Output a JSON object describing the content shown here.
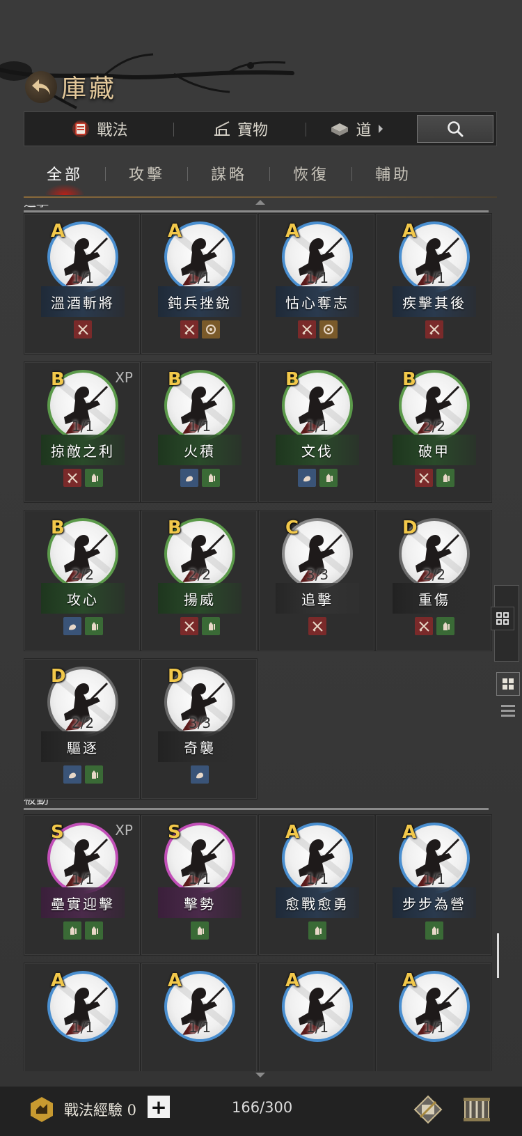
{
  "header": {
    "title": "庫藏"
  },
  "top_tabs": [
    {
      "label": "戰法",
      "icon": "war-tactic-icon"
    },
    {
      "label": "寶物",
      "icon": "treasure-icon"
    },
    {
      "label": "道",
      "icon": "item-icon"
    }
  ],
  "sub_tabs": [
    "全部",
    "攻擊",
    "謀略",
    "恢復",
    "輔助"
  ],
  "colors": {
    "accent": "#e3c89a",
    "S": "#c24fb8",
    "A": "#4a8fd0",
    "B": "#5b9a4a",
    "C": "#8a8a8a",
    "D": "#6a6a6a"
  },
  "sections": [
    {
      "label": "追擊",
      "tactics": [
        {
          "grade": "A",
          "count": "1/1",
          "name": "溫酒斬將",
          "xp": "",
          "tags": [
            "red"
          ]
        },
        {
          "grade": "A",
          "count": "1/1",
          "name": "鈍兵挫銳",
          "xp": "",
          "tags": [
            "red",
            "brown"
          ]
        },
        {
          "grade": "A",
          "count": "1/1",
          "name": "怙心奪志",
          "xp": "",
          "tags": [
            "red",
            "brown"
          ]
        },
        {
          "grade": "A",
          "count": "1/1",
          "name": "疾擊其後",
          "xp": "",
          "tags": [
            "red"
          ]
        },
        {
          "grade": "B",
          "count": "1/1",
          "name": "掠敵之利",
          "xp": "XP",
          "tags": [
            "red",
            "green"
          ]
        },
        {
          "grade": "B",
          "count": "1/1",
          "name": "火積",
          "xp": "",
          "tags": [
            "blue",
            "green"
          ]
        },
        {
          "grade": "B",
          "count": "1/1",
          "name": "文伐",
          "xp": "",
          "tags": [
            "blue",
            "green"
          ]
        },
        {
          "grade": "B",
          "count": "2/2",
          "name": "破甲",
          "xp": "",
          "tags": [
            "red",
            "green"
          ]
        },
        {
          "grade": "B",
          "count": "2/2",
          "name": "攻心",
          "xp": "",
          "tags": [
            "blue",
            "green"
          ]
        },
        {
          "grade": "B",
          "count": "2/2",
          "name": "揚威",
          "xp": "",
          "tags": [
            "red",
            "green"
          ]
        },
        {
          "grade": "C",
          "count": "3/3",
          "name": "追擊",
          "xp": "",
          "tags": [
            "red"
          ]
        },
        {
          "grade": "D",
          "count": "2/2",
          "name": "重傷",
          "xp": "",
          "tags": [
            "red",
            "green"
          ]
        },
        {
          "grade": "D",
          "count": "2/2",
          "name": "驅逐",
          "xp": "",
          "tags": [
            "blue",
            "green"
          ]
        },
        {
          "grade": "D",
          "count": "3/3",
          "name": "奇襲",
          "xp": "",
          "tags": [
            "blue"
          ]
        }
      ]
    },
    {
      "label": "被動",
      "tactics": [
        {
          "grade": "S",
          "count": "1/1",
          "name": "壘實迎擊",
          "xp": "XP",
          "tags": [
            "green",
            "green"
          ]
        },
        {
          "grade": "S",
          "count": "1/1",
          "name": "擊勢",
          "xp": "",
          "tags": [
            "green"
          ]
        },
        {
          "grade": "A",
          "count": "1/1",
          "name": "愈戰愈勇",
          "xp": "",
          "tags": [
            "green"
          ]
        },
        {
          "grade": "A",
          "count": "1/1",
          "name": "步步為營",
          "xp": "",
          "tags": [
            "green"
          ]
        },
        {
          "grade": "A",
          "count": "1/1",
          "name": "",
          "xp": "",
          "tags": []
        },
        {
          "grade": "A",
          "count": "1/1",
          "name": "",
          "xp": "",
          "tags": []
        },
        {
          "grade": "A",
          "count": "1/1",
          "name": "",
          "xp": "",
          "tags": []
        },
        {
          "grade": "A",
          "count": "1/1",
          "name": "",
          "xp": "",
          "tags": []
        }
      ]
    }
  ],
  "footer": {
    "xp_label": "戰法經驗 0",
    "capacity": "166/300"
  }
}
